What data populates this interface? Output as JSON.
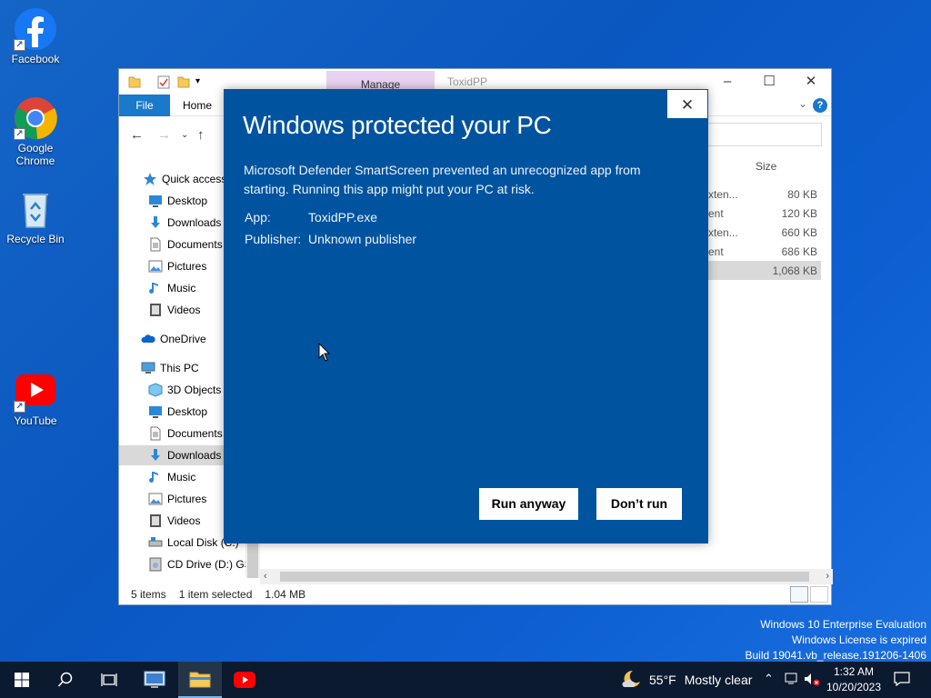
{
  "desktop": {
    "icons": [
      {
        "name": "facebook",
        "label": "Facebook"
      },
      {
        "name": "google-chrome",
        "label": "Google Chrome"
      },
      {
        "name": "recycle-bin",
        "label": "Recycle Bin"
      },
      {
        "name": "youtube",
        "label": "YouTube"
      }
    ],
    "watermark": {
      "line1": "Windows 10 Enterprise Evaluation",
      "line2": "Windows License is expired",
      "line3": "Build 19041.vb_release.191206-1406"
    }
  },
  "explorer": {
    "title": "ToxidPP",
    "manage_tab": "Manage",
    "ribbon": {
      "file": "File",
      "home": "Home"
    },
    "nav_items": [
      {
        "label": "Quick access",
        "icon": "star-icon"
      },
      {
        "label": "Desktop",
        "icon": "desktop-icon"
      },
      {
        "label": "Downloads",
        "icon": "download-icon"
      },
      {
        "label": "Documents",
        "icon": "document-icon"
      },
      {
        "label": "Pictures",
        "icon": "picture-icon"
      },
      {
        "label": "Music",
        "icon": "music-icon"
      },
      {
        "label": "Videos",
        "icon": "video-icon"
      },
      {
        "label": "OneDrive",
        "icon": "cloud-icon"
      },
      {
        "label": "This PC",
        "icon": "computer-icon"
      },
      {
        "label": "3D Objects",
        "icon": "cube-icon"
      },
      {
        "label": "Desktop",
        "icon": "desktop-icon"
      },
      {
        "label": "Documents",
        "icon": "document-icon"
      },
      {
        "label": "Downloads",
        "icon": "download-icon",
        "selected": true
      },
      {
        "label": "Music",
        "icon": "music-icon"
      },
      {
        "label": "Pictures",
        "icon": "picture-icon"
      },
      {
        "label": "Videos",
        "icon": "video-icon"
      },
      {
        "label": "Local Disk (C:)",
        "icon": "drive-icon"
      },
      {
        "label": "CD Drive (D:) GS",
        "icon": "cd-drive-icon"
      }
    ],
    "size_column": "Size",
    "files": [
      {
        "type": "xten...",
        "size": "80 KB"
      },
      {
        "type": "ent",
        "size": "120 KB"
      },
      {
        "type": "xten...",
        "size": "660 KB"
      },
      {
        "type": "ent",
        "size": "686 KB"
      },
      {
        "type": "",
        "size": "1,068 KB",
        "selected": true
      }
    ],
    "status": {
      "items": "5 items",
      "selected": "1 item selected",
      "size": "1.04 MB"
    }
  },
  "smartscreen": {
    "title": "Windows protected your PC",
    "message": "Microsoft Defender SmartScreen prevented an unrecognized app from starting. Running this app might put your PC at risk.",
    "app_label": "App:",
    "app_value": "ToxidPP.exe",
    "publisher_label": "Publisher:",
    "publisher_value": "Unknown publisher",
    "run_anyway": "Run anyway",
    "dont_run": "Don’t run",
    "colors": {
      "background": "#00539f"
    }
  },
  "taskbar": {
    "weather_temp": "55°F",
    "weather_text": "Mostly clear",
    "time": "1:32 AM",
    "date": "10/20/2023"
  }
}
